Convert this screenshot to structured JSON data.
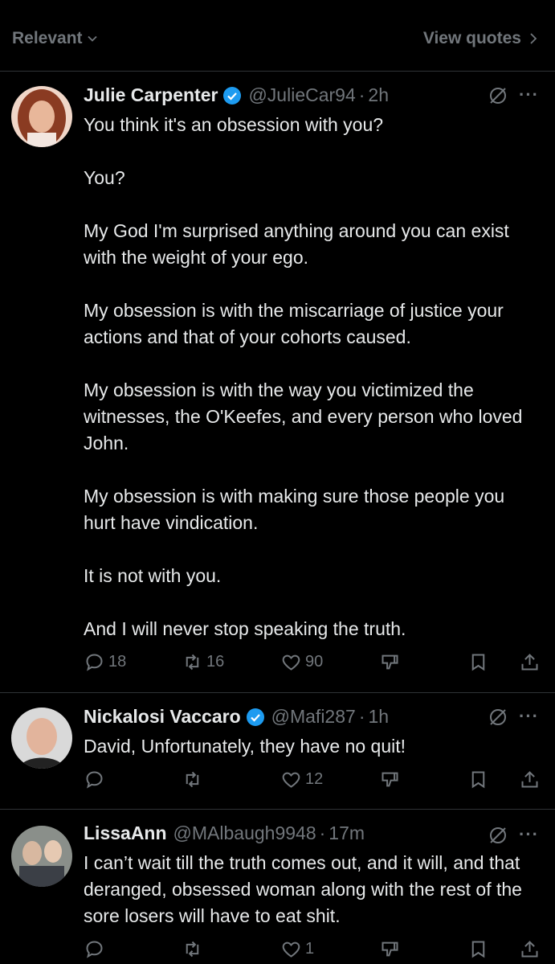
{
  "topbar": {
    "sort_label": "Relevant",
    "view_quotes_label": "View quotes"
  },
  "tweets": [
    {
      "name": "Julie Carpenter",
      "handle": "@JulieCar94",
      "time": "2h",
      "text": "You think it's an obsession with you?\n\nYou?\n\nMy God I'm surprised anything around you can exist with the weight of your ego.\n\nMy obsession is with the miscarriage  of justice your actions and that of your cohorts caused.\n\nMy obsession is with the way you victimized the witnesses, the O'Keefes, and every person who loved John.\n\nMy obsession is with making sure those people you hurt have vindication.\n\nIt is not with you.\n\nAnd I will never stop speaking the truth.",
      "replies": "18",
      "reposts": "16",
      "likes": "90"
    },
    {
      "name": "Nickalosi Vaccaro",
      "handle": "@Mafi287",
      "time": "1h",
      "text": "David, Unfortunately, they have no quit!",
      "replies": "",
      "reposts": "",
      "likes": "12"
    },
    {
      "name": "LissaAnn",
      "handle": "@MAlbaugh9948",
      "time": "17m",
      "text": "I can’t wait till the truth comes out, and it will, and that deranged, obsessed woman along with the rest of the sore losers will have to eat shit.",
      "replies": "",
      "reposts": "",
      "likes": "1"
    }
  ],
  "colors": {
    "background": "#000000",
    "text": "#e7e9ea",
    "muted": "#71767b",
    "verified": "#1d9bf0",
    "divider": "#2f3336"
  }
}
